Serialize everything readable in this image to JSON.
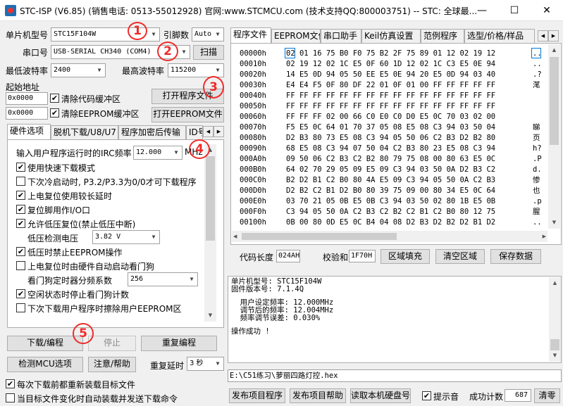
{
  "window": {
    "title": "STC-ISP (V6.85) (销售电话: 0513-55012928) 官网:www.STCMCU.com  (技术支持QQ:800003751)  -- STC: 全球最...",
    "minimize": "—",
    "maximize": "☐",
    "close": "✕"
  },
  "left": {
    "mcu_label": "单片机型号",
    "mcu_value": "STC15F104W",
    "pins_label": "引脚数",
    "pins_value": "Auto",
    "port_label": "串口号",
    "port_value": "USB-SERIAL CH340 (COM4)",
    "scan_button": "扫描",
    "min_baud_label": "最低波特率",
    "min_baud_value": "2400",
    "max_baud_label": "最高波特率",
    "max_baud_value": "115200",
    "start_addr_label": "起始地址",
    "addr1_value": "0x0000",
    "clear_code_label": "清除代码缓冲区",
    "open_program_button": "打开程序文件",
    "addr2_value": "0x0000",
    "clear_eeprom_label": "清除EEPROM缓冲区",
    "open_eeprom_button": "打开EEPROM文件"
  },
  "option_tabs": [
    "硬件选项",
    "脱机下载/U8/U7",
    "程序加密后传输",
    "ID号"
  ],
  "options": {
    "irc_label": "输入用户程序运行时的IRC频率",
    "irc_value": "12.000",
    "irc_unit": "MHz",
    "items": [
      {
        "label": "使用快速下载模式",
        "checked": true
      },
      {
        "label": "下次冷启动时, P3.2/P3.3为0/0才可下载程序",
        "checked": false
      },
      {
        "label": "上电复位使用较长延时",
        "checked": true
      },
      {
        "label": "复位脚用作I/O口",
        "checked": true
      },
      {
        "label": "允许低压复位(禁止低压中断)",
        "checked": true
      }
    ],
    "lvd_label": "低压检测电压",
    "lvd_value": "3.82 V",
    "items2": [
      {
        "label": "低压时禁止EEPROM操作",
        "checked": true
      },
      {
        "label": "上电复位时由硬件自动启动看门狗",
        "checked": false
      }
    ],
    "wdt_label": "看门狗定时器分频系数",
    "wdt_value": "256",
    "items3": [
      {
        "label": "空闲状态时停止看门狗计数",
        "checked": true
      },
      {
        "label": "下次下载用户程序时擦除用户EEPROM区",
        "checked": false
      }
    ]
  },
  "bottom_left": {
    "download_button": "下载/编程",
    "stop_button": "停止",
    "reprogram_button": "重复编程",
    "check_mcu_button": "检测MCU选项",
    "help_button": "注意/帮助",
    "repeat_delay_label": "重复延时",
    "repeat_delay_value": "3 秒",
    "reload_label": "每次下载前都重新装载目标文件",
    "auto_label": "当目标文件变化时自动装载并发送下载命令",
    "reload_checked": true,
    "auto_checked": false
  },
  "right_tabs": [
    "程序文件",
    "EEPROM文件",
    "串口助手",
    "Keil仿真设置",
    "范例程序",
    "选型/价格/样品"
  ],
  "hex": {
    "rows": [
      {
        "addr": "00000h",
        "bytes": "02 01 16 75 B0 F0 75 B2 2F 75 89 01 12 02 19 12",
        "ascii": ".."
      },
      {
        "addr": "00010h",
        "bytes": "02 19 12 02 1C E5 0F 60 1D 12 02 1C C3 E5 0E 94",
        "ascii": ".."
      },
      {
        "addr": "00020h",
        "bytes": "14 E5 0D 94 05 50 EE E5 0E 94 20 E5 0D 94 03 40",
        "ascii": ".?"
      },
      {
        "addr": "00030h",
        "bytes": "E4 E4 F5 0F 80 DF 22 01 0F 01 00 FF FF FF FF FF",
        "ascii": "滗"
      },
      {
        "addr": "00040h",
        "bytes": "FF FF FF FF FF FF FF FF FF FF FF FF FF FF FF FF",
        "ascii": ""
      },
      {
        "addr": "00050h",
        "bytes": "FF FF FF FF FF FF FF FF FF FF FF FF FF FF FF FF",
        "ascii": ""
      },
      {
        "addr": "00060h",
        "bytes": "FF FF FF 02 00 66 C0 E0 C0 D0 E5 0C 70 03 02 00",
        "ascii": ""
      },
      {
        "addr": "00070h",
        "bytes": "F5 E5 0C 64 01 70 37 05 08 E5 08 C3 94 03 50 04",
        "ascii": "睇"
      },
      {
        "addr": "00080h",
        "bytes": "D2 B3 80 73 E5 08 C3 94 05 50 06 C2 B3 D2 B2 80",
        "ascii": "页"
      },
      {
        "addr": "00090h",
        "bytes": "68 E5 08 C3 94 07 50 04 C2 B3 80 23 E5 08 C3 94",
        "ascii": "h?"
      },
      {
        "addr": "000A0h",
        "bytes": "09 50 06 C2 B3 C2 B2 80 79 75 08 00 80 63 E5 0C",
        "ascii": ".P"
      },
      {
        "addr": "000B0h",
        "bytes": "64 02 70 29 05 09 E5 09 C3 94 03 50 0A D2 B3 C2",
        "ascii": "d."
      },
      {
        "addr": "000C0h",
        "bytes": "B2 D2 B1 C2 B0 80 4A E5 09 C3 94 05 50 0A C2 B3",
        "ascii": "惨"
      },
      {
        "addr": "000D0h",
        "bytes": "D2 B2 C2 B1 D2 B0 80 39 75 09 00 80 34 E5 0C 64",
        "ascii": "也"
      },
      {
        "addr": "000E0h",
        "bytes": "03 70 21 05 0B E5 0B C3 94 03 50 02 80 1B E5 0B",
        "ascii": ".p"
      },
      {
        "addr": "000F0h",
        "bytes": "C3 94 05 50 0A C2 B3 C2 B2 C2 B1 C2 B0 80 12 75",
        "ascii": "腥"
      },
      {
        "addr": "00100h",
        "bytes": "0B 00 80 0D E5 0C B4 04 08 D2 B3 D2 B2 D2 B1 D2",
        "ascii": ".."
      }
    ],
    "code_len_label": "代码长度",
    "code_len_value": "024AH",
    "checksum_label": "校验和",
    "checksum_value": "1F70H",
    "fill_button": "区域填充",
    "clear_button": "清空区域",
    "save_button": "保存数据"
  },
  "log": {
    "lines": [
      "单片机型号: STC15F104W",
      "固件版本号: 7.1.4Q",
      "",
      "  用户设定频率: 12.000MHz",
      "  调节后的频率: 12.004MHz",
      "  频率调节误差: 0.030%",
      "",
      "操作成功 !"
    ]
  },
  "file_path": "E:\\C51练习\\萝丽四路灯控.hex",
  "bottom_right": {
    "publish_button": "发布项目程序",
    "publish_help_button": "发布项目帮助",
    "read_disk_button": "读取本机硬盘号",
    "beep_label": "提示音",
    "beep_checked": true,
    "success_count_label": "成功计数",
    "success_count_value": "687",
    "clear_count_button": "清零"
  },
  "annotations": [
    "1",
    "2",
    "3",
    "4",
    "5"
  ],
  "colors": {
    "annotation": "#ef2b2b",
    "selection": "#0078d7"
  }
}
